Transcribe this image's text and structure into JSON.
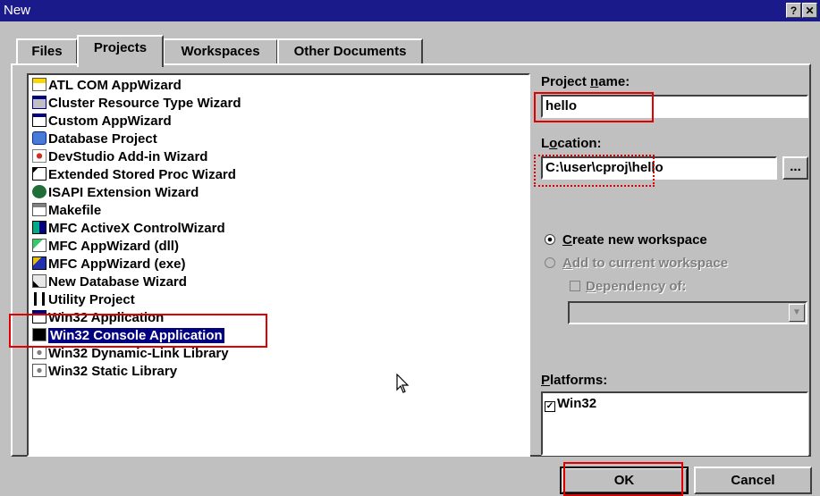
{
  "window": {
    "title": "New",
    "help_label": "?",
    "close_label": "✕"
  },
  "tabs": [
    {
      "label": "Files"
    },
    {
      "label": "Projects"
    },
    {
      "label": "Workspaces"
    },
    {
      "label": "Other Documents"
    }
  ],
  "active_tab": "Projects",
  "projects": [
    {
      "label": "ATL COM AppWizard",
      "icon": "atl-com-icon"
    },
    {
      "label": "Cluster Resource Type Wizard",
      "icon": "cluster-icon"
    },
    {
      "label": "Custom AppWizard",
      "icon": "custom-appwizard-icon"
    },
    {
      "label": "Database Project",
      "icon": "database-icon"
    },
    {
      "label": "DevStudio Add-in Wizard",
      "icon": "addin-icon"
    },
    {
      "label": "Extended Stored Proc Wizard",
      "icon": "stored-proc-icon"
    },
    {
      "label": "ISAPI Extension Wizard",
      "icon": "isapi-icon"
    },
    {
      "label": "Makefile",
      "icon": "makefile-icon"
    },
    {
      "label": "MFC ActiveX ControlWizard",
      "icon": "activex-icon"
    },
    {
      "label": "MFC AppWizard (dll)",
      "icon": "mfc-dll-icon"
    },
    {
      "label": "MFC AppWizard (exe)",
      "icon": "mfc-exe-icon"
    },
    {
      "label": "New Database Wizard",
      "icon": "new-database-icon"
    },
    {
      "label": "Utility Project",
      "icon": "utility-icon"
    },
    {
      "label": "Win32 Application",
      "icon": "win32-app-icon"
    },
    {
      "label": "Win32 Console Application",
      "icon": "console-icon",
      "selected": true
    },
    {
      "label": "Win32 Dynamic-Link Library",
      "icon": "dll-icon"
    },
    {
      "label": "Win32 Static Library",
      "icon": "static-lib-icon"
    }
  ],
  "project_name": {
    "label_pre": "Project ",
    "label_u": "n",
    "label_post": "ame:",
    "value": "hello"
  },
  "location": {
    "label_pre": "L",
    "label_u": "o",
    "label_post": "cation:",
    "value": "C:\\user\\cproj\\hello",
    "browse_label": "..."
  },
  "workspace": {
    "create_u": "C",
    "create_rest": "reate new workspace",
    "add_u": "A",
    "add_rest": "dd to current workspace",
    "dependency_u": "D",
    "dependency_rest": "ependency of:"
  },
  "platforms": {
    "label_u": "P",
    "label_rest": "latforms:",
    "items": [
      {
        "label": "Win32",
        "checked": true
      }
    ]
  },
  "buttons": {
    "ok": "OK",
    "cancel": "Cancel"
  },
  "colors": {
    "titlebar": "#1a1a8a",
    "highlight": "#000080",
    "annotation": "#e00000"
  }
}
